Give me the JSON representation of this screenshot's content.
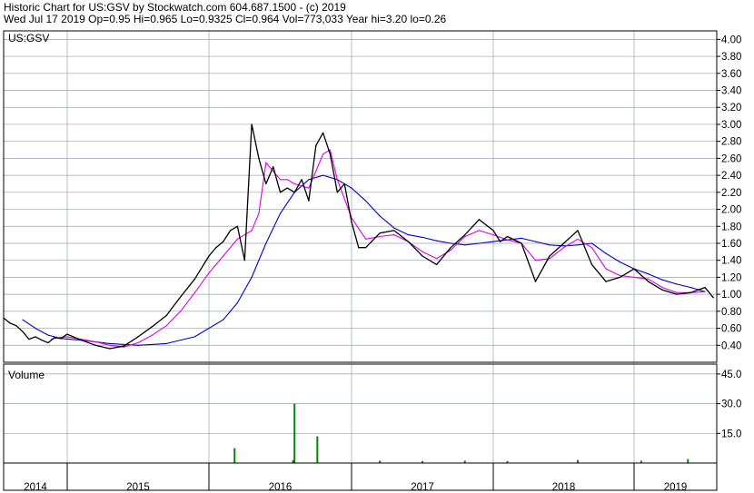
{
  "header": {
    "line1": "Historic Chart for US:GSV by Stockwatch.com 604.687.1500 - (c) 2019",
    "line2": "Wed Jul 17 2019  Op=0.95  Hi=0.965  Lo=0.9325  Cl=0.964  Vol=773,033  Year hi=3.20  lo=0.26"
  },
  "colors": {
    "price": "#000000",
    "ma_short": "#e000e0",
    "ma_long": "#0000cc",
    "vol_up": "#008800",
    "vol_down": "#cc0000",
    "grid": "#9aa3ad",
    "axis": "#000000"
  },
  "chart_data": [
    {
      "type": "line",
      "title": "US:GSV",
      "y_scale": "linear",
      "ylim": [
        0.2,
        4.1
      ],
      "y_ticks": [
        "0.40",
        "0.60",
        "0.80",
        "1.00",
        "1.20",
        "1.40",
        "1.60",
        "1.80",
        "2.00",
        "2.20",
        "2.40",
        "2.60",
        "2.80",
        "3.00",
        "3.20",
        "3.40",
        "3.60",
        "3.80",
        "4.00"
      ],
      "x_ticks": [
        "2014",
        "2015",
        "2016",
        "2017",
        "2018",
        "2019"
      ],
      "xlim": [
        2014.0,
        2019.56
      ],
      "grid": true,
      "series": [
        {
          "role": "price",
          "x": [
            2014.0,
            2014.1,
            2014.2,
            2014.3,
            2014.4,
            2014.5,
            2014.6,
            2014.7,
            2014.8,
            2014.9,
            2015.0,
            2015.1,
            2015.2,
            2015.3,
            2015.4,
            2015.5,
            2015.6,
            2015.7,
            2015.8,
            2015.9,
            2016.0,
            2016.05,
            2016.1,
            2016.15,
            2016.2,
            2016.25,
            2016.3,
            2016.35,
            2016.4,
            2016.45,
            2016.5,
            2016.55,
            2016.6,
            2016.65,
            2016.7,
            2016.75,
            2016.8,
            2016.85,
            2016.9,
            2016.95,
            2017.0,
            2017.05,
            2017.1,
            2017.2,
            2017.3,
            2017.4,
            2017.5,
            2017.6,
            2017.7,
            2017.8,
            2017.9,
            2018.0,
            2018.05,
            2018.1,
            2018.2,
            2018.3,
            2018.4,
            2018.5,
            2018.6,
            2018.7,
            2018.8,
            2018.9,
            2019.0,
            2019.1,
            2019.2,
            2019.3,
            2019.4,
            2019.5,
            2019.56
          ],
          "y": [
            0.72,
            0.66,
            0.63,
            0.56,
            0.47,
            0.5,
            0.46,
            0.43,
            0.49,
            0.48,
            0.53,
            0.46,
            0.4,
            0.36,
            0.39,
            0.5,
            0.62,
            0.75,
            0.97,
            1.18,
            1.45,
            1.55,
            1.62,
            1.75,
            1.8,
            1.4,
            3.0,
            2.6,
            2.3,
            2.5,
            2.2,
            2.25,
            2.2,
            2.35,
            2.1,
            2.75,
            2.9,
            2.65,
            2.2,
            2.3,
            1.85,
            1.55,
            1.55,
            1.72,
            1.75,
            1.62,
            1.45,
            1.35,
            1.55,
            1.7,
            1.88,
            1.75,
            1.62,
            1.68,
            1.6,
            1.15,
            1.45,
            1.6,
            1.75,
            1.35,
            1.15,
            1.2,
            1.3,
            1.15,
            1.05,
            1.0,
            1.02,
            1.08,
            0.96
          ]
        },
        {
          "role": "ma_short",
          "x": [
            2014.75,
            2014.85,
            2015.0,
            2015.1,
            2015.2,
            2015.3,
            2015.4,
            2015.5,
            2015.6,
            2015.7,
            2015.8,
            2015.9,
            2016.0,
            2016.1,
            2016.2,
            2016.3,
            2016.35,
            2016.4,
            2016.5,
            2016.55,
            2016.6,
            2016.7,
            2016.75,
            2016.8,
            2016.85,
            2016.9,
            2017.0,
            2017.1,
            2017.2,
            2017.3,
            2017.4,
            2017.5,
            2017.6,
            2017.7,
            2017.8,
            2017.9,
            2018.0,
            2018.1,
            2018.2,
            2018.3,
            2018.4,
            2018.5,
            2018.6,
            2018.7,
            2018.8,
            2018.9,
            2019.0,
            2019.1,
            2019.2,
            2019.3,
            2019.4,
            2019.5
          ],
          "y": [
            0.47,
            0.49,
            0.5,
            0.47,
            0.44,
            0.4,
            0.38,
            0.43,
            0.52,
            0.63,
            0.8,
            1.02,
            1.25,
            1.45,
            1.65,
            1.75,
            1.95,
            2.55,
            2.35,
            2.35,
            2.3,
            2.25,
            2.45,
            2.65,
            2.7,
            2.35,
            1.9,
            1.65,
            1.68,
            1.7,
            1.62,
            1.5,
            1.42,
            1.52,
            1.68,
            1.75,
            1.7,
            1.64,
            1.6,
            1.4,
            1.42,
            1.55,
            1.65,
            1.55,
            1.3,
            1.22,
            1.2,
            1.18,
            1.08,
            1.02,
            1.02,
            1.03
          ]
        },
        {
          "role": "ma_long",
          "x": [
            2014.3,
            2014.5,
            2014.7,
            2014.9,
            2015.1,
            2015.3,
            2015.5,
            2015.7,
            2015.9,
            2016.1,
            2016.2,
            2016.3,
            2016.4,
            2016.5,
            2016.6,
            2016.7,
            2016.8,
            2016.9,
            2017.0,
            2017.1,
            2017.2,
            2017.3,
            2017.4,
            2017.5,
            2017.6,
            2017.7,
            2017.8,
            2017.9,
            2018.0,
            2018.1,
            2018.2,
            2018.3,
            2018.4,
            2018.5,
            2018.6,
            2018.7,
            2018.8,
            2018.9,
            2019.0,
            2019.1,
            2019.2,
            2019.3,
            2019.4,
            2019.5
          ],
          "y": [
            0.7,
            0.6,
            0.52,
            0.48,
            0.46,
            0.42,
            0.4,
            0.42,
            0.5,
            0.7,
            0.9,
            1.2,
            1.6,
            1.95,
            2.2,
            2.35,
            2.4,
            2.35,
            2.25,
            2.1,
            1.92,
            1.78,
            1.7,
            1.67,
            1.63,
            1.6,
            1.58,
            1.6,
            1.62,
            1.64,
            1.66,
            1.62,
            1.58,
            1.57,
            1.58,
            1.6,
            1.48,
            1.38,
            1.3,
            1.24,
            1.17,
            1.12,
            1.08,
            1.03
          ]
        }
      ]
    },
    {
      "type": "bar",
      "title": "Volume",
      "ylim": [
        0,
        50
      ],
      "y_ticks": [
        "15.0",
        "30.0",
        "45.0"
      ],
      "grid": true,
      "x": [
        2016.18,
        2016.59,
        2016.6,
        2016.76,
        2017.2,
        2017.5,
        2017.8,
        2018.1,
        2018.6,
        2019.05,
        2019.38
      ],
      "values": [
        7.5,
        1.5,
        30.0,
        13.5,
        1.2,
        1.0,
        1.2,
        1.0,
        1.5,
        1.2,
        2.0
      ]
    }
  ]
}
